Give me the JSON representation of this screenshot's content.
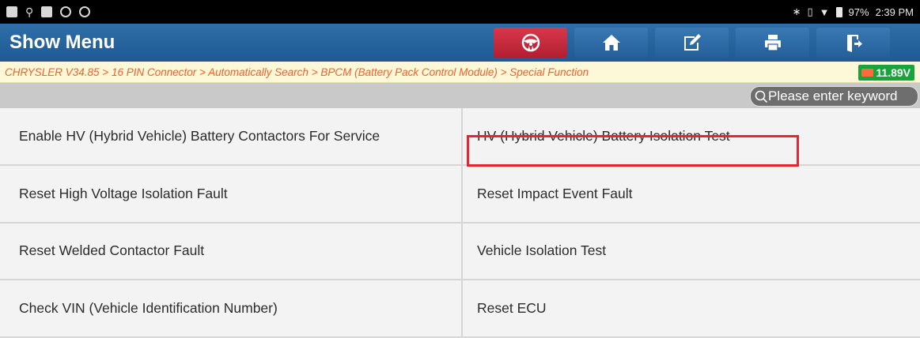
{
  "status_bar": {
    "time": "2:39 PM",
    "battery_percent": "97%",
    "icons_left": [
      "gallery-icon",
      "usb-icon",
      "file-icon",
      "pause-icon",
      "accessibility-icon"
    ],
    "icons_right": [
      "bluetooth-icon",
      "vibrate-icon",
      "wifi-icon",
      "battery-icon"
    ]
  },
  "toolbar": {
    "title": "Show Menu",
    "buttons": [
      {
        "name": "steering-wheel-button",
        "icon": "steering-wheel-icon",
        "color": "#c8283c"
      },
      {
        "name": "home-button",
        "icon": "home-icon",
        "color": "#2f6ea8"
      },
      {
        "name": "edit-report-button",
        "icon": "edit-icon",
        "color": "#2f6ea8"
      },
      {
        "name": "print-button",
        "icon": "printer-icon",
        "color": "#2f6ea8"
      },
      {
        "name": "exit-button",
        "icon": "exit-icon",
        "color": "#2f6ea8"
      }
    ]
  },
  "breadcrumb": {
    "text": "CHRYSLER V34.85 > 16 PIN Connector > Automatically Search > BPCM (Battery Pack Control Module) > Special Function",
    "voltage": "11.89V"
  },
  "search": {
    "placeholder": "Please enter keyword"
  },
  "menu": {
    "items": [
      "Enable HV (Hybrid Vehicle) Battery Contactors For Service",
      "HV (Hybrid Vehicle) Battery Isolation Test",
      "Reset High Voltage Isolation Fault",
      "Reset Impact Event Fault",
      "Reset Welded Contactor Fault",
      "Vehicle Isolation Test",
      "Check VIN (Vehicle Identification Number)",
      "Reset ECU"
    ],
    "highlighted_index": 1,
    "highlight_color": "#e3262f"
  }
}
